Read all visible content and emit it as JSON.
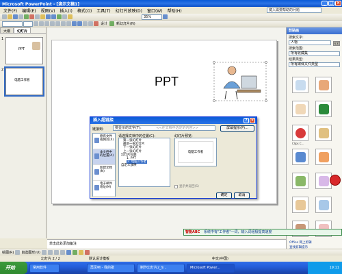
{
  "window": {
    "title": "Microsoft PowerPoint - [演示文稿1]",
    "min": "_",
    "max": "□",
    "close": "×"
  },
  "menu": {
    "items": [
      "文件(F)",
      "编辑(E)",
      "视图(V)",
      "插入(I)",
      "格式(O)",
      "工具(T)",
      "幻灯片放映(D)",
      "窗口(W)",
      "帮助(H)"
    ],
    "help_placeholder": "键入需要帮助的问题"
  },
  "toolbar": {
    "zoom": "35%",
    "design": "设计",
    "new_slide": "新幻灯片(N)"
  },
  "left_pane": {
    "tabs": [
      "大纲",
      "幻灯片"
    ],
    "slides": [
      {
        "num": "1",
        "text": "PPT"
      },
      {
        "num": "2",
        "text": "电脑工作者"
      }
    ]
  },
  "slide": {
    "title": "PPT"
  },
  "notes": {
    "placeholder": "单击此处添加备注"
  },
  "task_pane": {
    "title": "剪贴画",
    "search_label": "搜索文字:",
    "search_value": "人物",
    "go": "搜索",
    "range_label": "搜索范围:",
    "range_value": "所有收藏集",
    "type_label": "结果类型:",
    "type_value": "所有媒体文件类型",
    "caption": "Clips C...",
    "links": [
      "Office 网上剪辑",
      "查找剪辑提示"
    ]
  },
  "dialog": {
    "title": "插入超链接",
    "link_to": "链接到:",
    "display_label": "要显示的文字(T):",
    "display_placeholder": "<<在文档中选定的内容>>",
    "screentip": "屏幕提示(P)...",
    "places": [
      "原有文件或网页(X)",
      "本文档中的位置(A)",
      "新建文档(N)",
      "电子邮件地址(M)"
    ],
    "select_label": "请选择文档中的位置(C):",
    "tree": [
      "第一张幻灯片",
      "最后一张幻灯片",
      "下一张幻灯片",
      "上一张幻灯片",
      "幻灯片标题",
      "1. PPT",
      "2. 电脑工作者",
      "自定义放映"
    ],
    "preview_label": "幻灯片预览:",
    "preview_text": "电脑工作者",
    "show_return": "显示并返回(S)",
    "ok": "确定",
    "cancel": "取消",
    "help": "?",
    "close": "×"
  },
  "drawbar": {
    "draw": "绘图(R)",
    "autoshapes": "自选图形(U)"
  },
  "status": {
    "slide": "幻灯片 2 / 2",
    "design": "默认设计模板",
    "lang": "中文(中国)"
  },
  "taskbar": {
    "start": "开始",
    "tasks": [
      "常用软件",
      "再见吧 - 我的歌",
      "制作幻灯片2_9...",
      "Microsoft Power..."
    ],
    "clock": "19:11"
  },
  "marquee": {
    "brand": "智能ABC",
    "text": "系统中有\"工作者\"一词，输入词组极提高速度"
  }
}
